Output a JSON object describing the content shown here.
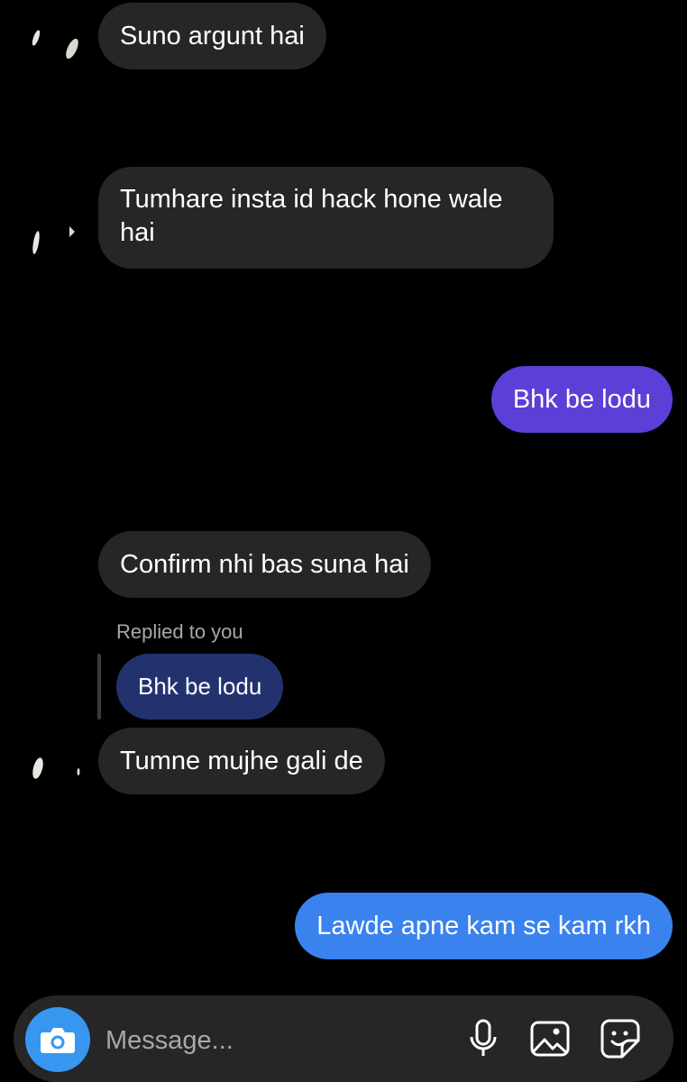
{
  "messages": [
    {
      "text": "Suno argunt hai",
      "direction": "incoming"
    },
    {
      "line1": "Tumhare insta id hack hone wale",
      "line2": "hai",
      "direction": "incoming"
    },
    {
      "text": "Bhk be lodu",
      "direction": "outgoing"
    },
    {
      "text": "Confirm nhi bas suna hai",
      "direction": "incoming"
    },
    {
      "text": "Tumne mujhe gali de",
      "direction": "incoming"
    },
    {
      "text": "Lawde apne kam se kam rkh",
      "direction": "outgoing"
    }
  ],
  "reply": {
    "label": "Replied to you",
    "quoted_text": "Bhk be lodu"
  },
  "composer": {
    "placeholder": "Message..."
  },
  "colors": {
    "background": "#000000",
    "incoming_bubble": "#262626",
    "outgoing_purple": "#5b3fd6",
    "outgoing_blue": "#3a82ee",
    "quoted_bubble": "#23326f",
    "camera_button": "#3797f0",
    "placeholder": "#a8a8a8"
  },
  "icons": {
    "camera": "camera-icon",
    "microphone": "microphone-icon",
    "gallery": "gallery-icon",
    "sticker": "sticker-icon"
  }
}
